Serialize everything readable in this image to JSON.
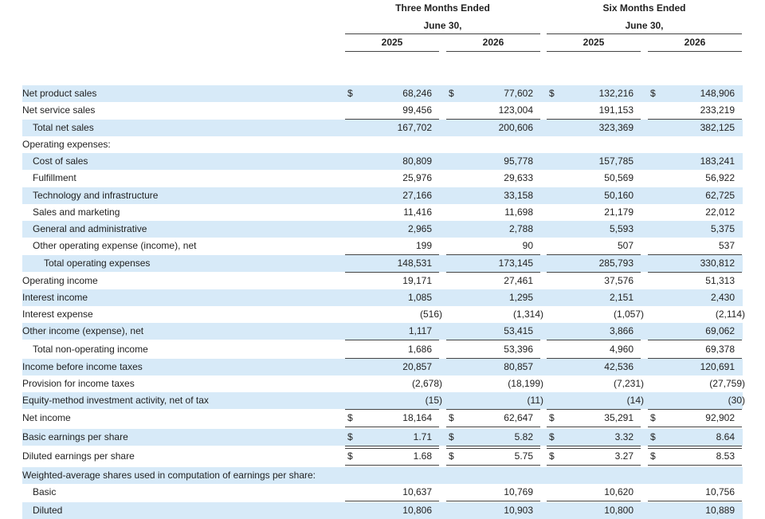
{
  "header": {
    "group1_line1": "Three Months Ended",
    "group1_line2": "June 30,",
    "group2_line1": "Six Months Ended",
    "group2_line2": "June 30,",
    "columns": [
      "2025",
      "2026",
      "2025",
      "2026"
    ]
  },
  "currency_symbol": "$",
  "colors": {
    "shade": "#d7eaf8",
    "rule": "#444444"
  },
  "rows": [
    {
      "label": "Net product sales",
      "indent": 0,
      "values": [
        "68,246",
        "77,602",
        "132,216",
        "148,906"
      ],
      "dollar": true,
      "shaded": true
    },
    {
      "label": "Net service sales",
      "indent": 0,
      "values": [
        "99,456",
        "123,004",
        "191,153",
        "233,219"
      ],
      "dollar": false,
      "shaded": false,
      "rule_below": "single"
    },
    {
      "label": "Total net sales",
      "indent": 1,
      "values": [
        "167,702",
        "200,606",
        "323,369",
        "382,125"
      ],
      "dollar": false,
      "shaded": true
    },
    {
      "label": "Operating expenses:",
      "indent": 0,
      "values": [
        "",
        "",
        "",
        ""
      ],
      "dollar": false,
      "shaded": false
    },
    {
      "label": "Cost of sales",
      "indent": 1,
      "values": [
        "80,809",
        "95,778",
        "157,785",
        "183,241"
      ],
      "dollar": false,
      "shaded": true
    },
    {
      "label": "Fulfillment",
      "indent": 1,
      "values": [
        "25,976",
        "29,633",
        "50,569",
        "56,922"
      ],
      "dollar": false,
      "shaded": false
    },
    {
      "label": "Technology and infrastructure",
      "indent": 1,
      "values": [
        "27,166",
        "33,158",
        "50,160",
        "62,725"
      ],
      "dollar": false,
      "shaded": true
    },
    {
      "label": "Sales and marketing",
      "indent": 1,
      "values": [
        "11,416",
        "11,698",
        "21,179",
        "22,012"
      ],
      "dollar": false,
      "shaded": false
    },
    {
      "label": "General and administrative",
      "indent": 1,
      "values": [
        "2,965",
        "2,788",
        "5,593",
        "5,375"
      ],
      "dollar": false,
      "shaded": true
    },
    {
      "label": "Other operating expense (income), net",
      "indent": 1,
      "values": [
        "199",
        "90",
        "507",
        "537"
      ],
      "dollar": false,
      "shaded": false,
      "rule_below": "single"
    },
    {
      "label": "Total operating expenses",
      "indent": 2,
      "values": [
        "148,531",
        "173,145",
        "285,793",
        "330,812"
      ],
      "dollar": false,
      "shaded": true,
      "rule_below": "single"
    },
    {
      "label": "Operating income",
      "indent": 0,
      "values": [
        "19,171",
        "27,461",
        "37,576",
        "51,313"
      ],
      "dollar": false,
      "shaded": false
    },
    {
      "label": "Interest income",
      "indent": 0,
      "values": [
        "1,085",
        "1,295",
        "2,151",
        "2,430"
      ],
      "dollar": false,
      "shaded": true
    },
    {
      "label": "Interest expense",
      "indent": 0,
      "values": [
        "(516)",
        "(1,314)",
        "(1,057)",
        "(2,114)"
      ],
      "dollar": false,
      "shaded": false
    },
    {
      "label": "Other income (expense), net",
      "indent": 0,
      "values": [
        "1,117",
        "53,415",
        "3,866",
        "69,062"
      ],
      "dollar": false,
      "shaded": true,
      "rule_below": "single"
    },
    {
      "label": "Total non-operating income",
      "indent": 1,
      "values": [
        "1,686",
        "53,396",
        "4,960",
        "69,378"
      ],
      "dollar": false,
      "shaded": false,
      "rule_below": "single"
    },
    {
      "label": "Income before income taxes",
      "indent": 0,
      "values": [
        "20,857",
        "80,857",
        "42,536",
        "120,691"
      ],
      "dollar": false,
      "shaded": true
    },
    {
      "label": "Provision for income taxes",
      "indent": 0,
      "values": [
        "(2,678)",
        "(18,199)",
        "(7,231)",
        "(27,759)"
      ],
      "dollar": false,
      "shaded": false
    },
    {
      "label": "Equity-method investment activity, net of tax",
      "indent": 0,
      "values": [
        "(15)",
        "(11)",
        "(14)",
        "(30)"
      ],
      "dollar": false,
      "shaded": true,
      "rule_below": "single"
    },
    {
      "label": "Net income",
      "indent": 0,
      "values": [
        "18,164",
        "62,647",
        "35,291",
        "92,902"
      ],
      "dollar": true,
      "shaded": false,
      "rule_below": "double"
    },
    {
      "label": "Basic earnings per share",
      "indent": 0,
      "values": [
        "1.71",
        "5.82",
        "3.32",
        "8.64"
      ],
      "dollar": true,
      "shaded": true,
      "rule_below": "double"
    },
    {
      "label": "Diluted earnings per share",
      "indent": 0,
      "values": [
        "1.68",
        "5.75",
        "3.27",
        "8.53"
      ],
      "dollar": true,
      "shaded": false,
      "rule_below": "double"
    },
    {
      "label": "Weighted-average shares used in computation of earnings per share:",
      "indent": 0,
      "values": [
        "",
        "",
        "",
        ""
      ],
      "dollar": false,
      "shaded": true
    },
    {
      "label": "Basic",
      "indent": 1,
      "values": [
        "10,637",
        "10,769",
        "10,620",
        "10,756"
      ],
      "dollar": false,
      "shaded": false,
      "rule_below": "double"
    },
    {
      "label": "Diluted",
      "indent": 1,
      "values": [
        "10,806",
        "10,903",
        "10,800",
        "10,889"
      ],
      "dollar": false,
      "shaded": true
    }
  ]
}
